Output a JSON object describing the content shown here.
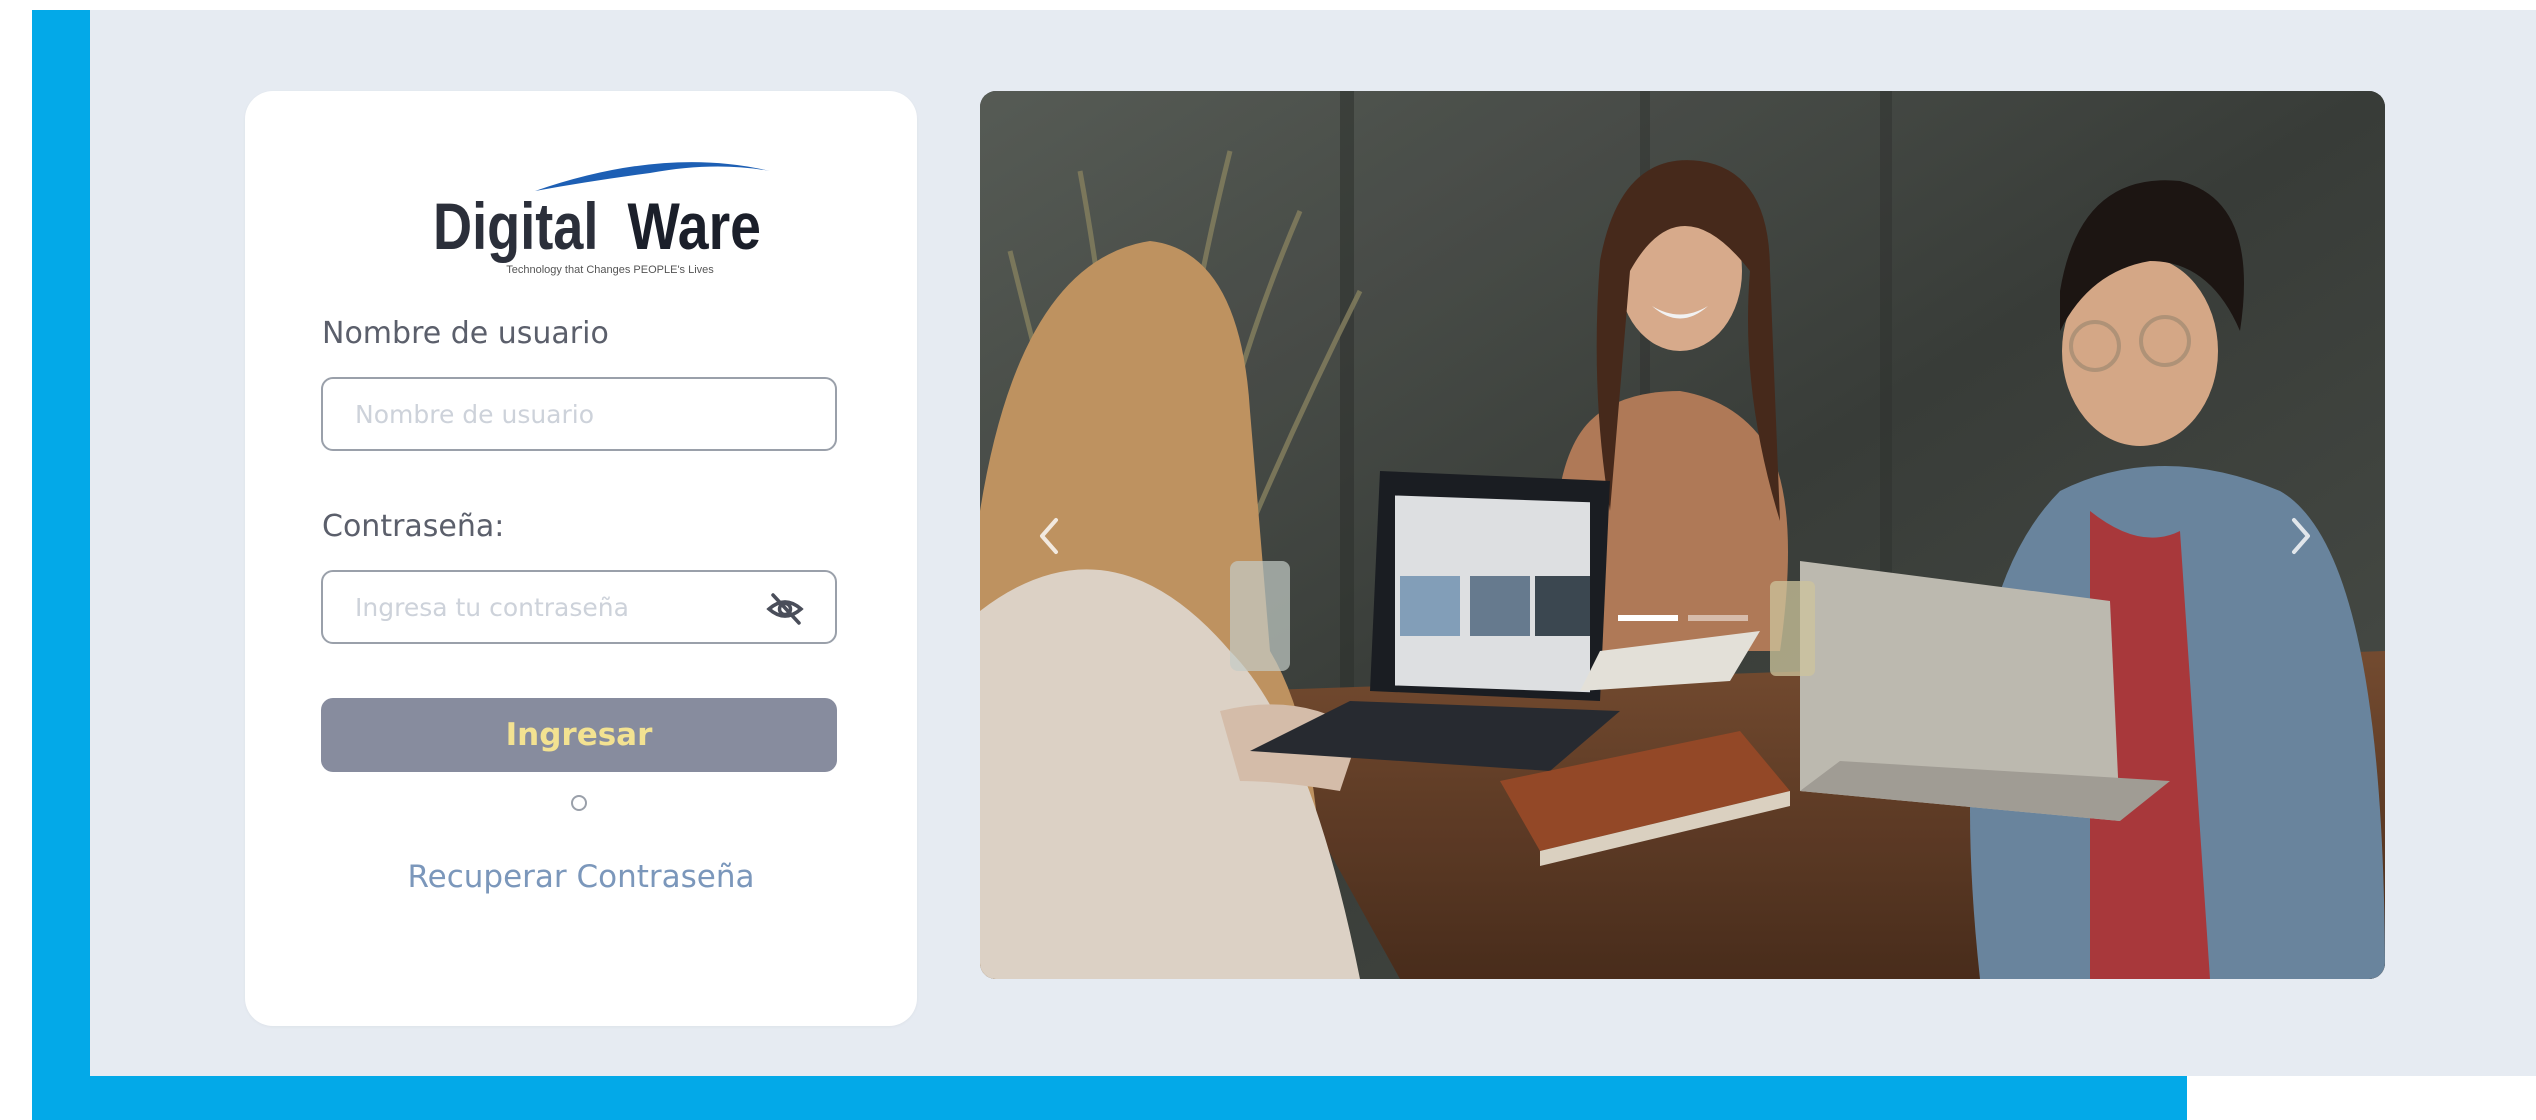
{
  "brand": {
    "logo_main": "Digital",
    "logo_accent": "Ware",
    "tagline": "Technology that Changes PEOPLE's Lives"
  },
  "login": {
    "username_label": "Nombre de usuario",
    "username_placeholder": "Nombre de usuario",
    "password_label": "Contraseña:",
    "password_placeholder": "Ingresa tu contraseña",
    "submit_label": "Ingresar",
    "recover_link": "Recuperar Contraseña"
  },
  "carousel": {
    "prev_icon": "chevron-left-icon",
    "next_icon": "chevron-right-icon",
    "slide_count": 2,
    "active_slide": 1
  },
  "colors": {
    "frame_blue": "#03a9e8",
    "background": "#e6ebf2",
    "button_bg": "#878c9e",
    "button_text": "#f3e291",
    "link": "#7b97bb",
    "logo_dark": "#2b2f3a",
    "logo_blue": "#1d5fb4"
  }
}
